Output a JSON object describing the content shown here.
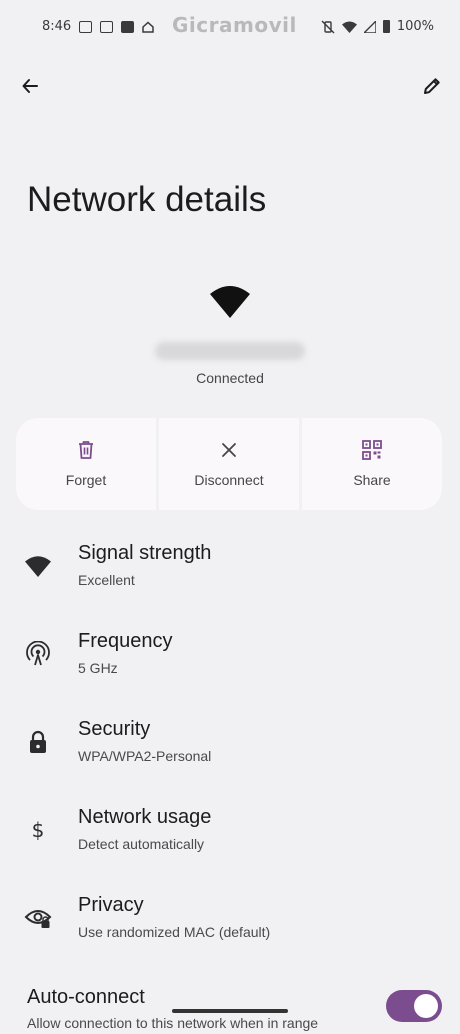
{
  "status_bar": {
    "time": "8:46",
    "brand": "Gicramovil",
    "battery": "100%",
    "left_icons": [
      "gmail-icon",
      "calendar-icon",
      "youtube-icon",
      "home-icon"
    ],
    "right_icons": [
      "vibrate-off-icon",
      "wifi-icon",
      "signal-icon",
      "battery-icon"
    ]
  },
  "header": {
    "back_icon": "arrow-back-icon",
    "edit_icon": "pencil-icon"
  },
  "page": {
    "title": "Network details",
    "network_icon": "wifi-icon",
    "status": "Connected"
  },
  "actions": [
    {
      "label": "Forget",
      "icon": "trash-icon"
    },
    {
      "label": "Disconnect",
      "icon": "close-icon"
    },
    {
      "label": "Share",
      "icon": "qr-code-icon"
    }
  ],
  "details": [
    {
      "title": "Signal strength",
      "subtitle": "Excellent",
      "icon": "wifi-icon"
    },
    {
      "title": "Frequency",
      "subtitle": "5 GHz",
      "icon": "antenna-icon"
    },
    {
      "title": "Security",
      "subtitle": "WPA/WPA2-Personal",
      "icon": "lock-icon"
    },
    {
      "title": "Network usage",
      "subtitle": "Detect automatically",
      "icon": "dollar-icon"
    },
    {
      "title": "Privacy",
      "subtitle": "Use randomized MAC (default)",
      "icon": "privacy-eye-icon"
    }
  ],
  "auto_connect": {
    "title": "Auto-connect",
    "subtitle": "Allow connection to this network when in range",
    "enabled": true
  },
  "colors": {
    "background": "#f1f0f2",
    "accent": "#7b4c8e",
    "action_card": "#fbf8fb",
    "text_primary": "#1c1b1f",
    "text_secondary": "#4a4a4e"
  }
}
